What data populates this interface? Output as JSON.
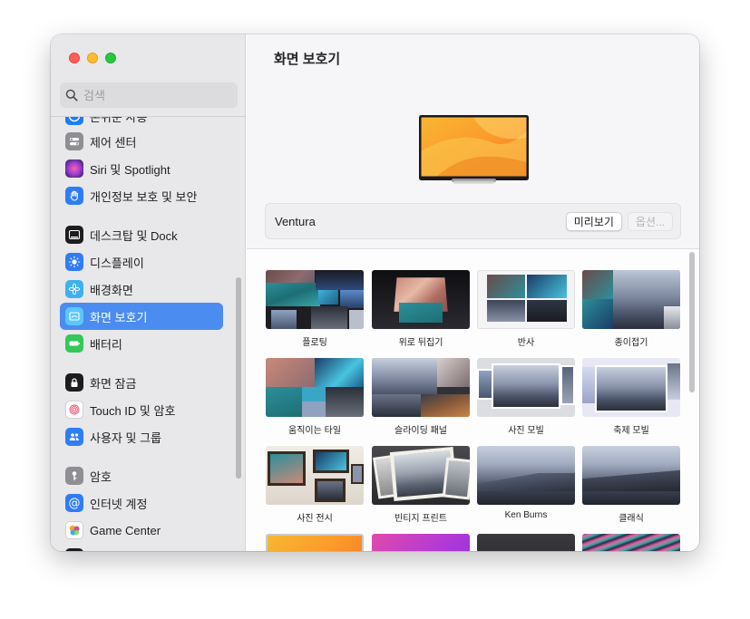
{
  "window": {
    "title": "화면 보호기"
  },
  "search": {
    "placeholder": "검색"
  },
  "sidebar": {
    "items": [
      {
        "label": "손쉬운 사용",
        "icon": "accessibility-icon",
        "color": "#1e7cf2"
      },
      {
        "label": "제어 센터",
        "icon": "control-center-icon",
        "color": "#8e8e93"
      },
      {
        "label": "Siri 및 Spotlight",
        "icon": "siri-icon",
        "color": "#a03fd6"
      },
      {
        "label": "개인정보 보호 및 보안",
        "icon": "hand-icon",
        "color": "#2f7cf6"
      },
      {
        "label": "데스크탑 및 Dock",
        "icon": "dock-icon",
        "color": "#1c1c1e"
      },
      {
        "label": "디스플레이",
        "icon": "display-sun-icon",
        "color": "#2f7cf6"
      },
      {
        "label": "배경화면",
        "icon": "wallpaper-flower-icon",
        "color": "#3eb1f0"
      },
      {
        "label": "화면 보호기",
        "icon": "screensaver-icon",
        "color": "#5ac8fa"
      },
      {
        "label": "배터리",
        "icon": "battery-icon",
        "color": "#34c759"
      },
      {
        "label": "화면 잠금",
        "icon": "lock-icon",
        "color": "#1c1c1e"
      },
      {
        "label": "Touch ID 및 암호",
        "icon": "fingerprint-icon",
        "color": "#ffffff"
      },
      {
        "label": "사용자 및 그룹",
        "icon": "users-icon",
        "color": "#2f7cf6"
      },
      {
        "label": "암호",
        "icon": "key-icon",
        "color": "#8e8e93"
      },
      {
        "label": "인터넷 계정",
        "icon": "at-icon",
        "color": "#2f7cf6"
      },
      {
        "label": "Game Center",
        "icon": "game-center-icon",
        "color": "#ffffff"
      },
      {
        "label": "",
        "icon": "wallet-icon",
        "color": "#1c1c1e"
      }
    ],
    "active_index": 7
  },
  "main": {
    "title": "화면 보호기",
    "selected_name": "Ventura",
    "preview_button": "미리보기",
    "options_button": "옵션...",
    "tiles": [
      {
        "label": "플로팅"
      },
      {
        "label": "위로 뒤집기"
      },
      {
        "label": "반사"
      },
      {
        "label": "종이접기"
      },
      {
        "label": "움직이는 타일"
      },
      {
        "label": "슬라이딩 패널"
      },
      {
        "label": "사진 모빌"
      },
      {
        "label": "축제 모빌"
      },
      {
        "label": "사진 전시"
      },
      {
        "label": "빈티지 프린트"
      },
      {
        "label": "Ken Burns"
      },
      {
        "label": "클래식"
      },
      {
        "label": ""
      },
      {
        "label": ""
      },
      {
        "label": ""
      },
      {
        "label": ""
      }
    ]
  },
  "colors": {
    "accent": "#4a8cf0",
    "sidebar_bg": "#e8e7ea",
    "content_bg": "#f6f5f7"
  }
}
